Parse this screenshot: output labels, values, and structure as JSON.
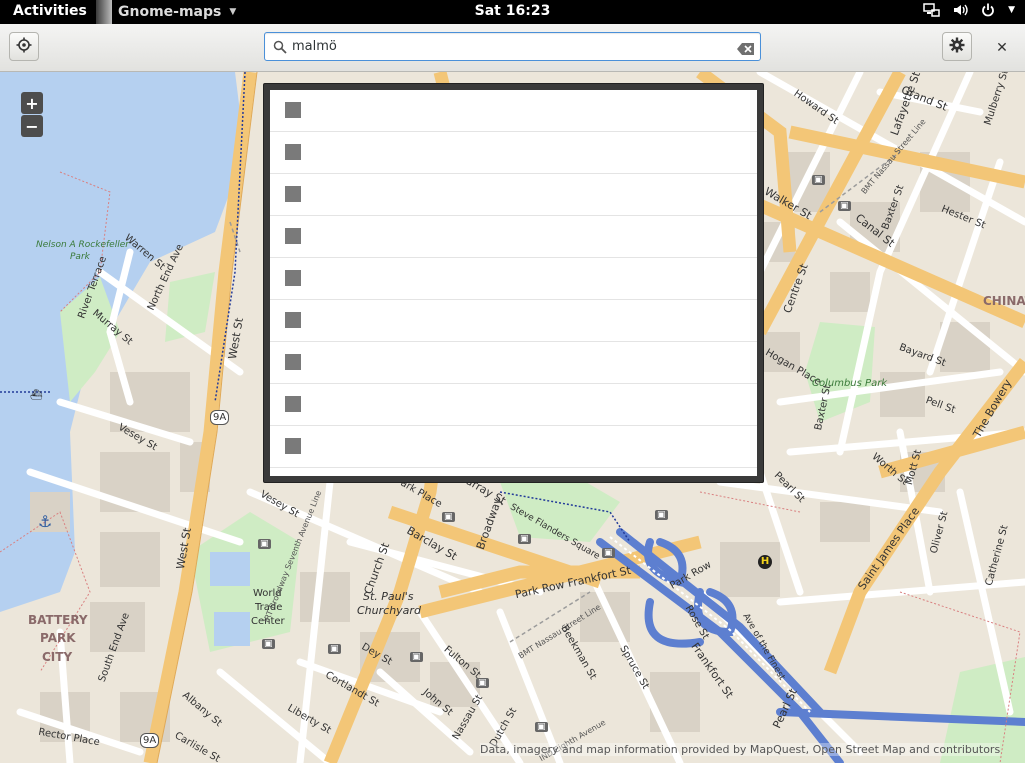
{
  "topbar": {
    "activities": "Activities",
    "app_name": "Gnome-maps",
    "clock": "Sat 16:23",
    "tray_icons": [
      "network-icon",
      "volume-icon",
      "power-icon"
    ]
  },
  "header": {
    "search_value": "malmö",
    "locate_icon": "crosshair-icon",
    "settings_icon": "gear-icon",
    "close_label": "✕"
  },
  "map": {
    "zoom_in": "+",
    "zoom_out": "−",
    "attribution": "Data, imagery and map information provided by MapQuest, Open Street Map and contributors",
    "labels": {
      "nelson": "Nelson A Rockefeller",
      "park": "Park",
      "warren": "Warren St",
      "north_end": "North End Ave",
      "river_terrace": "River Terrace",
      "murray_w": "Murray St",
      "west_st": "West St",
      "west_st2": "West St",
      "vesey": "Vesey St",
      "vesey2": "Vesey St",
      "battery1": "BATTERY",
      "battery2": "PARK",
      "battery3": "CITY",
      "south_end": "South End Ave",
      "rector": "Rector Place",
      "albany": "Albany St",
      "carlisle": "Carlisle St",
      "liberty": "Liberty St",
      "cortlandt": "Cortlandt St",
      "dey": "Dey St",
      "fulton": "Fulton St",
      "john": "John St",
      "nassau": "Nassau St",
      "dutch": "Dutch St",
      "church": "Church St",
      "barclay": "Barclay St",
      "broadway": "Broadway",
      "murray_e": "Murray St",
      "park_place": "Park Place",
      "stpauls1": "St. Paul's",
      "stpauls2": "Churchyard",
      "wtc1": "World",
      "wtc2": "Trade",
      "wtc3": "Center",
      "irt": "IRT Broadway Seventh Avenue Line",
      "steve": "Steve Flanders Square",
      "park_row_frankfort": "Park Row Frankfort St",
      "park_row": "Park Row",
      "bmt_nassau": "BMT Nassau Street Line",
      "beekman": "Beekman St",
      "spruce": "Spruce St",
      "frankfort": "Frankfort St",
      "rose": "Rose St",
      "ave_finest": "Ave of the Finest",
      "pearl": "Pearl St",
      "pearl2": "Pearl St",
      "howard": "Howard St",
      "grand": "Grand St",
      "lafayette": "Lafayette St",
      "mulberry": "Mulberry St",
      "walker": "Walker St",
      "canal": "Canal St",
      "baxter": "Baxter St",
      "bmt_canal": "BMT Nassau Street Line",
      "hester": "Hester St",
      "centre": "Centre St",
      "chinatown": "CHINAT",
      "hogan": "Hogan Place",
      "columbus": "Columbus Park",
      "baxter2": "Baxter St",
      "bayard": "Bayard St",
      "pell": "Pell St",
      "bowery": "The Bowery",
      "worth": "Worth St",
      "mott": "Mott St",
      "oliver": "Oliver St",
      "catherine": "Catherine St",
      "st_james": "Saint James Place",
      "ind_eighth": "IND Eighth Avenue",
      "ninea": "9A",
      "ninea2": "9A"
    }
  },
  "results": {
    "rows": [
      "",
      "",
      "",
      "",
      "",
      "",
      "",
      "",
      ""
    ]
  }
}
